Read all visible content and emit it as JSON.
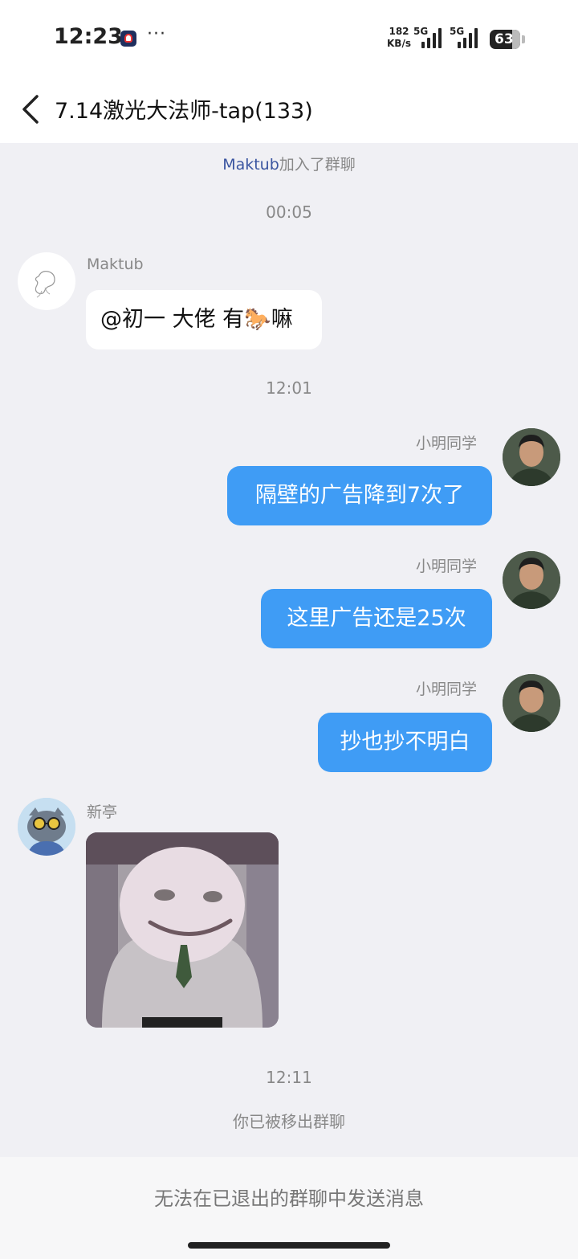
{
  "status_bar": {
    "time": "12:23",
    "more": "···",
    "speed_value": "182",
    "speed_unit": "KB/s",
    "network1": "5G",
    "network2": "5G",
    "battery": "63"
  },
  "header": {
    "title": "7.14激光大法师-tap(133)"
  },
  "messages": {
    "join_name": "Maktub",
    "join_text": "加入了群聊",
    "time1": "00:05",
    "m1_sender": "Maktub",
    "m1_text": "@初一 大佬 有🐎嘛",
    "time2": "12:01",
    "m2_sender": "小明同学",
    "m2_text": "隔壁的广告降到7次了",
    "m3_sender": "小明同学",
    "m3_text": "这里广告还是25次",
    "m4_sender": "小明同学",
    "m4_text": "抄也抄不明白",
    "m5_sender": "新亭",
    "time3": "12:11",
    "removed_text": "你已被移出群聊"
  },
  "footer": {
    "text": "无法在已退出的群聊中发送消息"
  },
  "colors": {
    "outgoing_bubble": "#3f9cf5",
    "background": "#f0f0f4",
    "link_name": "#3a55a0"
  },
  "icons": [
    "back-icon",
    "app-notification-icon",
    "signal-icon",
    "battery-icon"
  ]
}
